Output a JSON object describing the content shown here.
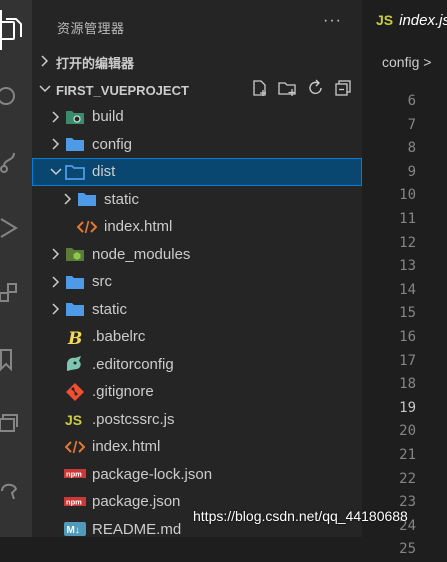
{
  "activity_bar": [
    "files-icon",
    "search-icon",
    "source-control-icon",
    "run-debug-icon",
    "extensions-icon",
    "bookmark-icon",
    "remote-icon",
    "settings-icon"
  ],
  "sidebar": {
    "title": "资源管理器",
    "more": "···",
    "open_editors": "打开的编辑器",
    "project": "FIRST_VUEPROJECT"
  },
  "tree": [
    {
      "name": "build",
      "type": "folder",
      "icon": "settings-folder-icon",
      "depth": 0,
      "open": false
    },
    {
      "name": "config",
      "type": "folder",
      "icon": "folder-icon",
      "depth": 0,
      "open": false
    },
    {
      "name": "dist",
      "type": "folder",
      "icon": "folder-open-icon",
      "depth": 0,
      "open": true,
      "selected": true
    },
    {
      "name": "static",
      "type": "folder",
      "icon": "folder-icon",
      "depth": 1,
      "open": false
    },
    {
      "name": "index.html",
      "type": "file",
      "icon": "html-icon",
      "depth": 1
    },
    {
      "name": "node_modules",
      "type": "folder",
      "icon": "node-folder-icon",
      "depth": 0,
      "open": false
    },
    {
      "name": "src",
      "type": "folder",
      "icon": "folder-icon",
      "depth": 0,
      "open": false
    },
    {
      "name": "static",
      "type": "folder",
      "icon": "folder-icon",
      "depth": 0,
      "open": false
    },
    {
      "name": ".babelrc",
      "type": "file",
      "icon": "babel-icon",
      "depth": 0
    },
    {
      "name": ".editorconfig",
      "type": "file",
      "icon": "editorconfig-icon",
      "depth": 0
    },
    {
      "name": ".gitignore",
      "type": "file",
      "icon": "git-icon",
      "depth": 0
    },
    {
      "name": ".postcssrc.js",
      "type": "file",
      "icon": "js-icon",
      "depth": 0
    },
    {
      "name": "index.html",
      "type": "file",
      "icon": "html-icon",
      "depth": 0
    },
    {
      "name": "package-lock.json",
      "type": "file",
      "icon": "npm-icon",
      "depth": 0
    },
    {
      "name": "package.json",
      "type": "file",
      "icon": "npm-icon",
      "depth": 0
    },
    {
      "name": "README.md",
      "type": "file",
      "icon": "markdown-icon",
      "depth": 0
    }
  ],
  "editor": {
    "tab_lang": "JS",
    "tab_name": "index.js",
    "breadcrumb": "config >",
    "line_numbers": [
      "6",
      "7",
      "8",
      "9",
      "10",
      "11",
      "12",
      "13",
      "14",
      "15",
      "16",
      "17",
      "18",
      "19",
      "20",
      "21",
      "22",
      "23",
      "24",
      "25"
    ],
    "current_line": "19"
  },
  "watermark": "https://blog.csdn.net/qq_44180688",
  "colors": {
    "selection": "#094771",
    "folder": "#4e9ae6",
    "html": "#e37933",
    "js": "#cbcb41",
    "git": "#f14e32",
    "npm": "#cb3837"
  }
}
